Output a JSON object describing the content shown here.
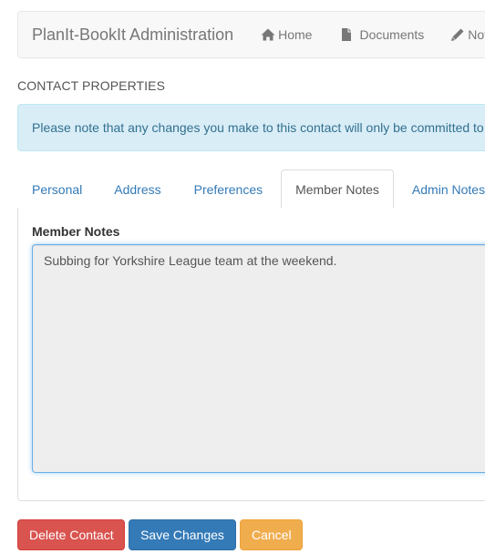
{
  "navbar": {
    "brand": "PlanIt-BookIt Administration",
    "links": [
      {
        "label": "Home",
        "icon": "home-icon"
      },
      {
        "label": "Documents",
        "icon": "file-icon"
      },
      {
        "label": "Notes",
        "icon": "pencil-icon"
      }
    ]
  },
  "page": {
    "section_title": "CONTACT PROPERTIES",
    "alert_text": "Please note that any changes you make to this contact will only be committed to the database when you click Save Changes."
  },
  "tabs": [
    {
      "label": "Personal",
      "active": false
    },
    {
      "label": "Address",
      "active": false
    },
    {
      "label": "Preferences",
      "active": false
    },
    {
      "label": "Member Notes",
      "active": true
    },
    {
      "label": "Admin Notes",
      "active": false
    }
  ],
  "member_notes": {
    "label": "Member Notes",
    "value": "Subbing for Yorkshire League team at the weekend."
  },
  "buttons": {
    "delete": "Delete Contact",
    "save": "Save Changes",
    "cancel": "Cancel"
  },
  "colors": {
    "link": "#337ab7",
    "danger": "#d9534f",
    "primary": "#337ab7",
    "warning": "#f0ad4e",
    "info_bg": "#d9edf7",
    "info_text": "#31708f"
  }
}
